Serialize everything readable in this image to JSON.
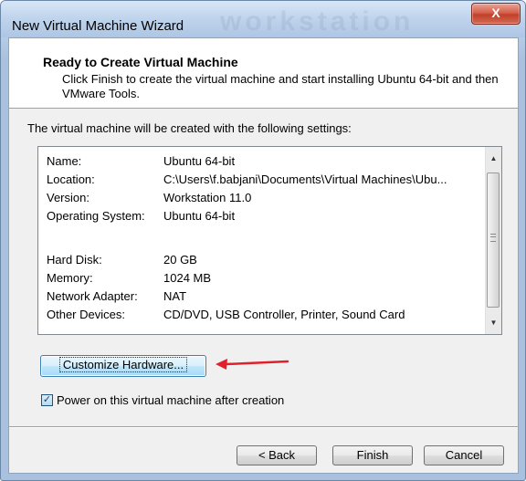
{
  "window": {
    "title": "New Virtual Machine Wizard",
    "watermark": "workstation",
    "close_label": "X"
  },
  "header": {
    "title": "Ready to Create Virtual Machine",
    "description": "Click Finish to create the virtual machine and start installing Ubuntu 64-bit and then VMware Tools."
  },
  "intro": "The virtual machine will be created with the following settings:",
  "settings": [
    {
      "label": "Name:",
      "value": "Ubuntu 64-bit"
    },
    {
      "label": "Location:",
      "value": "C:\\Users\\f.babjani\\Documents\\Virtual Machines\\Ubu..."
    },
    {
      "label": "Version:",
      "value": "Workstation 11.0"
    },
    {
      "label": "Operating System:",
      "value": "Ubuntu 64-bit"
    },
    {
      "label": "",
      "value": ""
    },
    {
      "label": "Hard Disk:",
      "value": "20 GB"
    },
    {
      "label": "Memory:",
      "value": "1024 MB"
    },
    {
      "label": "Network Adapter:",
      "value": "NAT"
    },
    {
      "label": "Other Devices:",
      "value": "CD/DVD, USB Controller, Printer, Sound Card"
    }
  ],
  "customize_button": "Customize Hardware...",
  "power_on": {
    "label": "Power on this virtual machine after creation",
    "checked": true
  },
  "footer": {
    "back_label": "< Back",
    "finish_label": "Finish",
    "cancel_label": "Cancel"
  },
  "annotation_color": "#e0202a"
}
